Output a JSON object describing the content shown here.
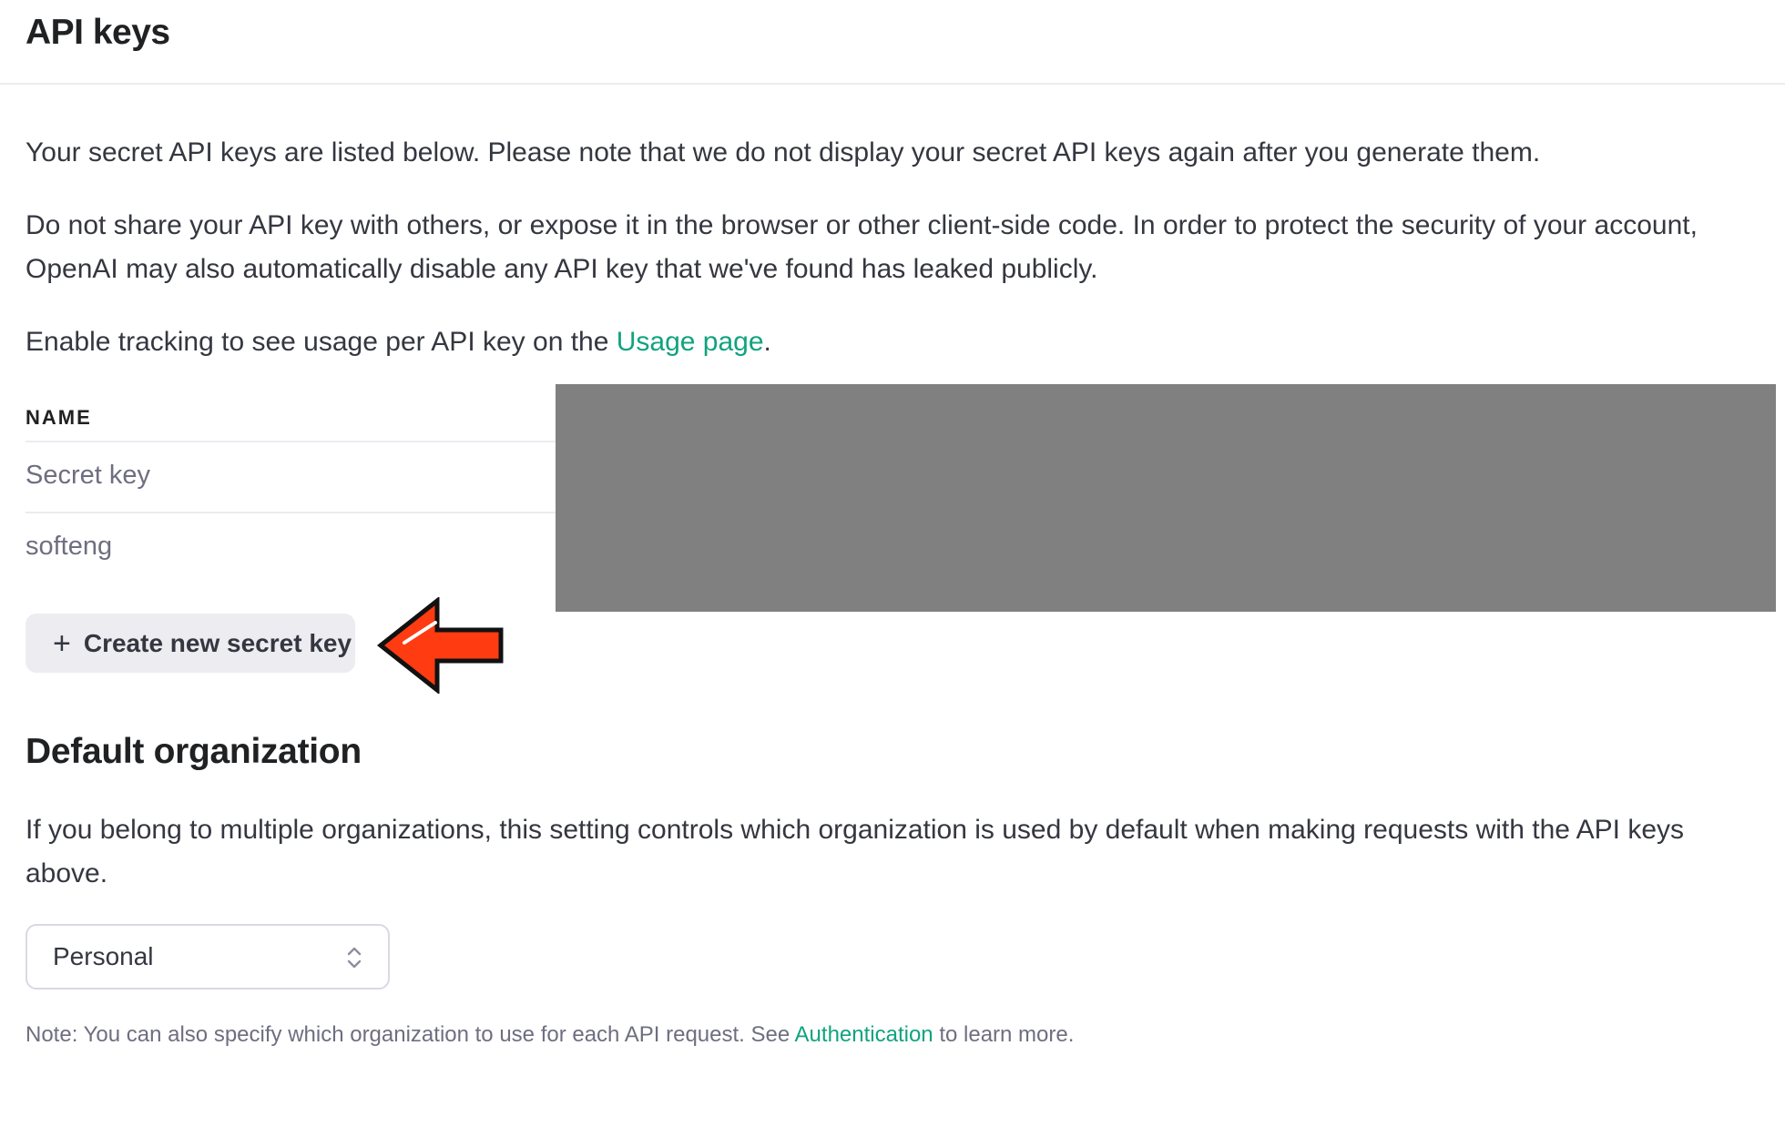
{
  "header": {
    "title": "API keys"
  },
  "intro": {
    "p1": "Your secret API keys are listed below. Please note that we do not display your secret API keys again after you generate them.",
    "p2": "Do not share your API key with others, or expose it in the browser or other client-side code. In order to protect the security of your account, OpenAI may also automatically disable any API key that we've found has leaked publicly.",
    "p3_prefix": "Enable tracking to see usage per API key on the ",
    "p3_link": "Usage page",
    "p3_suffix": "."
  },
  "keys_table": {
    "header_name": "NAME",
    "rows": [
      {
        "name": "Secret key"
      },
      {
        "name": "softeng"
      }
    ]
  },
  "create_button": {
    "icon": "plus-icon",
    "label": "Create new secret key"
  },
  "annotation": {
    "icon": "arrow-left-icon",
    "color": "#ff3b12"
  },
  "default_org": {
    "title": "Default organization",
    "description": "If you belong to multiple organizations, this setting controls which organization is used by default when making requests with the API keys above.",
    "selected": "Personal",
    "select_icon": "chevron-up-down-icon"
  },
  "note": {
    "prefix": "Note: You can also specify which organization to use for each API request. See ",
    "link": "Authentication",
    "suffix": " to learn more."
  },
  "colors": {
    "accent": "#10a37f",
    "button_bg": "#ececf1",
    "redaction": "#808080"
  }
}
